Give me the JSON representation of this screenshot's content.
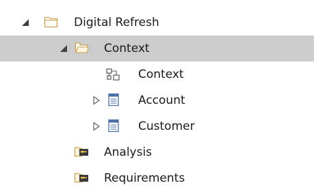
{
  "tree": {
    "items": [
      {
        "label": "Digital Refresh",
        "icon": "folder-icon",
        "expanded": true,
        "selected": false
      },
      {
        "label": "Context",
        "icon": "package-open-icon",
        "expanded": true,
        "selected": true
      },
      {
        "label": "Context",
        "icon": "diagram-icon",
        "selected": false
      },
      {
        "label": "Account",
        "icon": "class-icon",
        "expanded": false,
        "selected": false
      },
      {
        "label": "Customer",
        "icon": "class-icon",
        "expanded": false,
        "selected": false
      },
      {
        "label": "Analysis",
        "icon": "component-icon",
        "selected": false
      },
      {
        "label": "Requirements",
        "icon": "component-icon",
        "selected": false
      }
    ]
  },
  "colors": {
    "selection": "#cccccc",
    "folder": "#c9a25a",
    "class_icon": "#4a6fa5",
    "text": "#1a1a1a"
  }
}
